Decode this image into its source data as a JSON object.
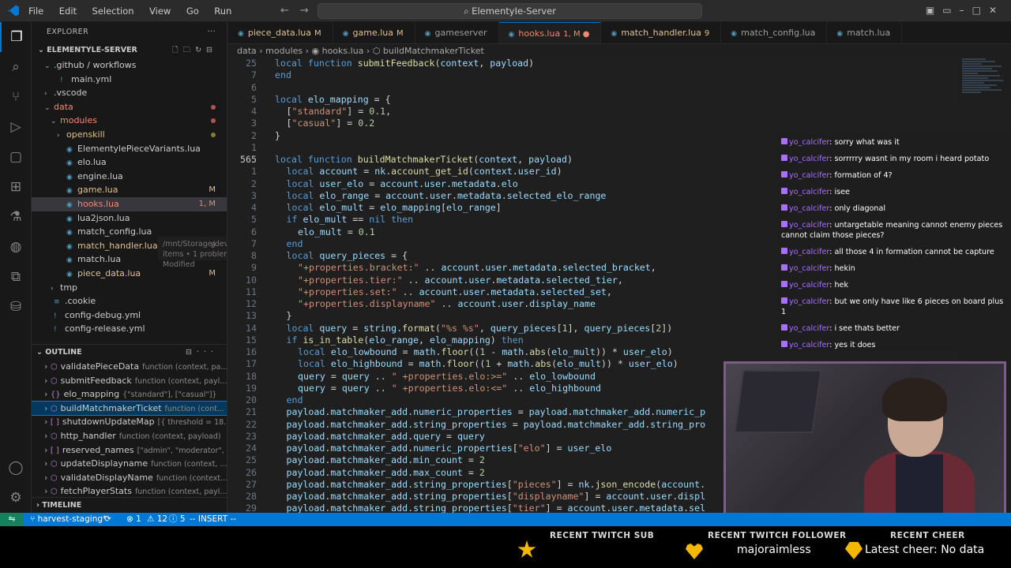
{
  "menu": [
    "File",
    "Edit",
    "Selection",
    "View",
    "Go",
    "Run"
  ],
  "search_text": "ElementyIe-Server",
  "explorer": {
    "title": "EXPLORER",
    "project": "ELEMENTYLE-SERVER",
    "tree": [
      {
        "label": ".github / workflows",
        "indent": 1,
        "chev": "⌄",
        "icon": "",
        "cls": "",
        "badge": "",
        "dot": ""
      },
      {
        "label": "main.yml",
        "indent": 2,
        "chev": "",
        "icon": "!",
        "cls": "",
        "badge": "",
        "dot": ""
      },
      {
        "label": ".vscode",
        "indent": 1,
        "chev": "›",
        "icon": "",
        "cls": "",
        "badge": "",
        "dot": ""
      },
      {
        "label": "data",
        "indent": 1,
        "chev": "⌄",
        "icon": "",
        "cls": "err",
        "badge": "",
        "dot": "red"
      },
      {
        "label": "modules",
        "indent": 2,
        "chev": "⌄",
        "icon": "",
        "cls": "err",
        "badge": "",
        "dot": "red"
      },
      {
        "label": "openskill",
        "indent": 3,
        "chev": "›",
        "icon": "",
        "cls": "mod",
        "badge": "",
        "dot": "yel"
      },
      {
        "label": "ElementylePieceVariants.lua",
        "indent": 3,
        "chev": "",
        "icon": "◉",
        "cls": "",
        "badge": "",
        "dot": ""
      },
      {
        "label": "elo.lua",
        "indent": 3,
        "chev": "",
        "icon": "◉",
        "cls": "",
        "badge": "",
        "dot": ""
      },
      {
        "label": "engine.lua",
        "indent": 3,
        "chev": "",
        "icon": "◉",
        "cls": "",
        "badge": "",
        "dot": ""
      },
      {
        "label": "game.lua",
        "indent": 3,
        "chev": "",
        "icon": "◉",
        "cls": "mod",
        "badge": "M",
        "dot": ""
      },
      {
        "label": "hooks.lua",
        "indent": 3,
        "chev": "",
        "icon": "◉",
        "cls": "err",
        "badge": "1, M",
        "dot": "",
        "selected": true
      },
      {
        "label": "lua2json.lua",
        "indent": 3,
        "chev": "",
        "icon": "◉",
        "cls": "",
        "badge": "",
        "dot": ""
      },
      {
        "label": "match_config.lua",
        "indent": 3,
        "chev": "",
        "icon": "◉",
        "cls": "",
        "badge": "",
        "dot": ""
      },
      {
        "label": "match_handler.lua",
        "indent": 3,
        "chev": "",
        "icon": "◉",
        "cls": "mod",
        "badge": "9",
        "dot": ""
      },
      {
        "label": "match.lua",
        "indent": 3,
        "chev": "",
        "icon": "◉",
        "cls": "",
        "badge": "",
        "dot": ""
      },
      {
        "label": "piece_data.lua",
        "indent": 3,
        "chev": "",
        "icon": "◉",
        "cls": "mod",
        "badge": "M",
        "dot": ""
      },
      {
        "label": "tmp",
        "indent": 2,
        "chev": "›",
        "icon": "",
        "cls": "",
        "badge": "",
        "dot": ""
      },
      {
        "label": ".cookie",
        "indent": 1,
        "chev": "",
        "icon": "≡",
        "cls": "",
        "badge": "",
        "dot": ""
      },
      {
        "label": "config-debug.yml",
        "indent": 1,
        "chev": "",
        "icon": "!",
        "cls": "",
        "badge": "",
        "dot": ""
      },
      {
        "label": "config-release.yml",
        "indent": 1,
        "chev": "",
        "icon": "!",
        "cls": "",
        "badge": "",
        "dot": ""
      }
    ],
    "tooltip_path": "/mnt/Storage/dev/ElementyIe-Server/data/modules/hooks.lua • Contains emphasized items • 1 problem in this file •",
    "tooltip_status": "Modified"
  },
  "outline": {
    "title": "OUTLINE",
    "items": [
      {
        "sym": "⬡",
        "name": "validatePieceData",
        "detail": "function (context, pa..."
      },
      {
        "sym": "⬡",
        "name": "submitFeedback",
        "detail": "function (context, payl..."
      },
      {
        "sym": "{}",
        "name": "elo_mapping",
        "detail": "{\"standard\"], [\"casual\"]}"
      },
      {
        "sym": "⬡",
        "name": "buildMatchmakerTicket",
        "detail": "function (cont...",
        "selected": true
      },
      {
        "sym": "[ ]",
        "name": "shutdownUpdateMap",
        "detail": "[{ threshold = 18..."
      },
      {
        "sym": "⬡",
        "name": "http_handler",
        "detail": "function (context, payload)"
      },
      {
        "sym": "[ ]",
        "name": "reserved_names",
        "detail": "[\"admin\", \"moderator\", ..."
      },
      {
        "sym": "⬡",
        "name": "updateDisplayname",
        "detail": "function (context, ..."
      },
      {
        "sym": "⬡",
        "name": "validateDisplayName",
        "detail": "function (context..."
      },
      {
        "sym": "⬡",
        "name": "fetchPlayerStats",
        "detail": "function (context, payl..."
      }
    ]
  },
  "timeline_title": "TIMELINE",
  "tabs": [
    {
      "label": "piece_data.lua",
      "status": "M",
      "cls": "mod",
      "active": false
    },
    {
      "label": "game.lua",
      "status": "M",
      "cls": "mod",
      "active": false
    },
    {
      "label": "gameserver",
      "status": "",
      "cls": "",
      "active": false
    },
    {
      "label": "hooks.lua",
      "status": "1, M ●",
      "cls": "err",
      "active": true
    },
    {
      "label": "match_handler.lua",
      "status": "9",
      "cls": "mod",
      "active": false
    },
    {
      "label": "match_config.lua",
      "status": "",
      "cls": "",
      "active": false
    },
    {
      "label": "match.lua",
      "status": "",
      "cls": "",
      "active": false
    }
  ],
  "breadcrumb": "data  ›  modules  ›  ◉ hooks.lua  ›  ⬡ buildMatchmakerTicket",
  "code": [
    {
      "n": "25",
      "t": "local function submitFeedback(context, payload)",
      "i": 0
    },
    {
      "n": "7",
      "t": "end",
      "i": 0
    },
    {
      "n": "6",
      "t": "",
      "i": 0
    },
    {
      "n": "5",
      "t": "local elo_mapping = {",
      "i": 0
    },
    {
      "n": "4",
      "t": "[\"standard\"] = 0.1,",
      "i": 1
    },
    {
      "n": "3",
      "t": "[\"casual\"] = 0.2",
      "i": 1
    },
    {
      "n": "2",
      "t": "}",
      "i": 0
    },
    {
      "n": "1",
      "t": "",
      "i": 0
    },
    {
      "n": "565",
      "t": "local function buildMatchmakerTicket(context, payload)",
      "i": 0,
      "cur": true
    },
    {
      "n": "1",
      "t": "local account = nk.account_get_id(context.user_id)",
      "i": 1
    },
    {
      "n": "2",
      "t": "local user_elo = account.user.metadata.elo",
      "i": 1
    },
    {
      "n": "3",
      "t": "local elo_range = account.user.metadata.selected_elo_range",
      "i": 1
    },
    {
      "n": "4",
      "t": "local elo_mult = elo_mapping[elo_range]",
      "i": 1
    },
    {
      "n": "5",
      "t": "if elo_mult == nil then",
      "i": 1
    },
    {
      "n": "6",
      "t": "elo_mult = 0.1",
      "i": 2
    },
    {
      "n": "7",
      "t": "end",
      "i": 1
    },
    {
      "n": "8",
      "t": "local query_pieces = {",
      "i": 1
    },
    {
      "n": "9",
      "t": "\"+properties.bracket:\" .. account.user.metadata.selected_bracket,",
      "i": 2
    },
    {
      "n": "10",
      "t": "\"+properties.tier:\" .. account.user.metadata.selected_tier,",
      "i": 2
    },
    {
      "n": "11",
      "t": "\"+properties.set:\" .. account.user.metadata.selected_set,",
      "i": 2
    },
    {
      "n": "12",
      "t": "\"+properties.displayname\" .. account.user.display_name",
      "i": 2
    },
    {
      "n": "13",
      "t": "}",
      "i": 1
    },
    {
      "n": "14",
      "t": "local query = string.format(\"%s %s\", query_pieces[1], query_pieces[2])",
      "i": 1
    },
    {
      "n": "15",
      "t": "if is_in_table(elo_range, elo_mapping) then",
      "i": 1
    },
    {
      "n": "16",
      "t": "local elo_lowbound = math.floor((1 - math.abs(elo_mult)) * user_elo)",
      "i": 2
    },
    {
      "n": "17",
      "t": "local elo_highbound = math.floor((1 + math.abs(elo_mult)) * user_elo)",
      "i": 2
    },
    {
      "n": "18",
      "t": "query = query .. \" +properties.elo:>=\" .. elo_lowbound",
      "i": 2
    },
    {
      "n": "19",
      "t": "query = query .. \" +properties.elo:<=\" .. elo_highbound",
      "i": 2
    },
    {
      "n": "20",
      "t": "end",
      "i": 1
    },
    {
      "n": "21",
      "t": "payload.matchmaker_add.numeric_properties = payload.matchmaker_add.numeric_p",
      "i": 1
    },
    {
      "n": "22",
      "t": "payload.matchmaker_add.string_properties = payload.matchmaker_add.string_pro",
      "i": 1
    },
    {
      "n": "23",
      "t": "payload.matchmaker_add.query = query",
      "i": 1
    },
    {
      "n": "24",
      "t": "payload.matchmaker_add.numeric_properties[\"elo\"] = user_elo",
      "i": 1
    },
    {
      "n": "25",
      "t": "payload.matchmaker_add.min_count = 2",
      "i": 1
    },
    {
      "n": "26",
      "t": "payload.matchmaker_add.max_count = 2",
      "i": 1
    },
    {
      "n": "27",
      "t": "payload.matchmaker_add.string_properties[\"pieces\"] = nk.json_encode(account.",
      "i": 1
    },
    {
      "n": "28",
      "t": "payload.matchmaker_add.string_properties[\"displayname\"] = account.user.displ",
      "i": 1
    },
    {
      "n": "29",
      "t": "payload.matchmaker_add.string_properties[\"tier\"] = account.user.metadata.sel",
      "i": 1
    }
  ],
  "chat": [
    {
      "user": "yo_calcifer",
      "msg": "sorry what was it"
    },
    {
      "user": "yo_calcifer",
      "msg": "sorrrrry wasnt in my room i heard potato"
    },
    {
      "user": "yo_calcifer",
      "msg": "formation of 4?"
    },
    {
      "user": "yo_calcifer",
      "msg": "isee"
    },
    {
      "user": "yo_calcifer",
      "msg": "only diagonal"
    },
    {
      "user": "yo_calcifer",
      "msg": "untargetable meaning cannot enemy pieces cannot claim those pieces?"
    },
    {
      "user": "yo_calcifer",
      "msg": "all those 4 in formation cannot be capture"
    },
    {
      "user": "yo_calcifer",
      "msg": "hekin"
    },
    {
      "user": "yo_calcifer",
      "msg": "hek"
    },
    {
      "user": "yo_calcifer",
      "msg": "but we only have like 6 pieces on board plus 1"
    },
    {
      "user": "yo_calcifer",
      "msg": "i see thats better"
    },
    {
      "user": "yo_calcifer",
      "msg": "yes it does"
    }
  ],
  "status": {
    "branch": "harvest-staging*",
    "sync": "⟳",
    "errors": "⊗ 1",
    "warnings": "⚠ 12",
    "info": "ⓘ 5",
    "mode": "-- INSERT --"
  },
  "overlay": {
    "sub_title": "RECENT TWITCH SUB",
    "follower_title": "RECENT TWITCH FOLLOWER",
    "follower_name": "majoraimless",
    "cheer_title": "RECENT CHEER",
    "cheer_text": "Latest cheer: No data"
  },
  "colors": {
    "accent": "#0078d4",
    "statusbar": "#0078d4",
    "remote": "#16825d",
    "chat_name": "#a970ff",
    "overlay_icon": "#f5b700"
  }
}
